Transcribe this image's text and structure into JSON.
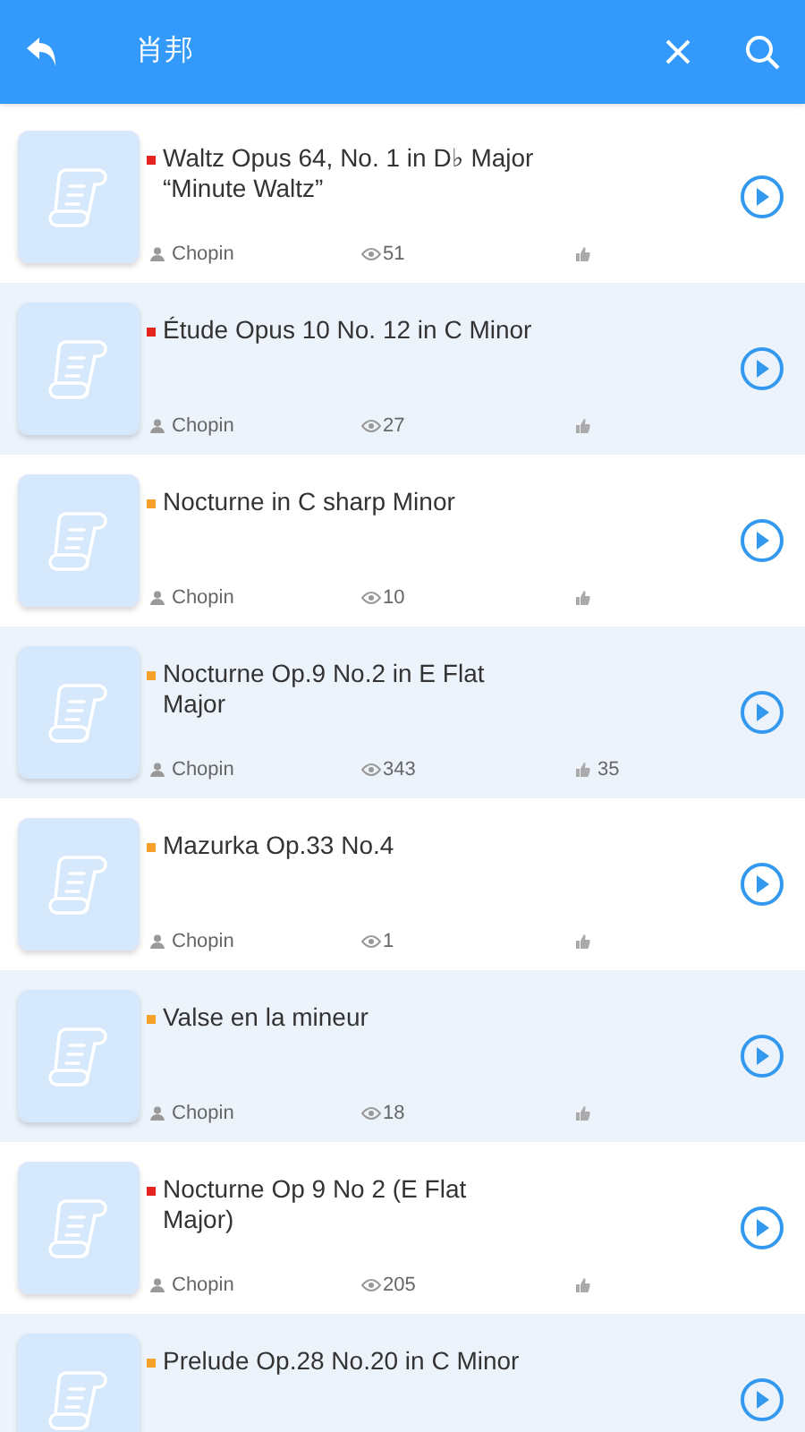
{
  "header": {
    "title": "肖邦"
  },
  "pieces": [
    {
      "title": "Waltz Opus 64, No. 1 in D♭ Major “Minute Waltz”",
      "color": "#e5231f",
      "author": "Chopin",
      "views": "51"
    },
    {
      "title": "Étude Opus 10 No. 12 in C Minor",
      "color": "#e5231f",
      "author": "Chopin",
      "views": "27"
    },
    {
      "title": "Nocturne in C sharp Minor",
      "color": "#f5a02a",
      "author": "Chopin",
      "views": "10"
    },
    {
      "title": "Nocturne Op.9 No.2 in E Flat Major",
      "color": "#f5a02a",
      "author": "Chopin",
      "views": "343",
      "likes": "35"
    },
    {
      "title": "Mazurka Op.33 No.4",
      "color": "#f5a02a",
      "author": "Chopin",
      "views": "1"
    },
    {
      "title": "Valse en la mineur",
      "color": "#f5a02a",
      "author": "Chopin",
      "views": "18"
    },
    {
      "title": "Nocturne Op 9 No 2 (E Flat Major)",
      "color": "#e5231f",
      "author": "Chopin",
      "views": "205"
    },
    {
      "title": "Prelude Op.28 No.20 in C Minor",
      "color": "#f5a02a"
    }
  ]
}
